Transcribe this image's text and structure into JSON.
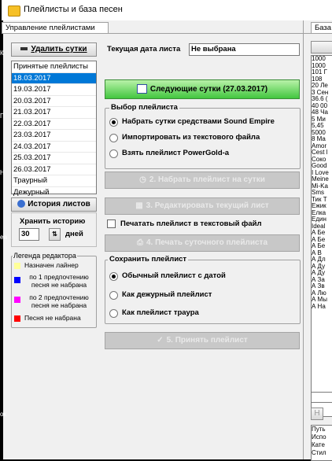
{
  "window": {
    "title": "Плейлисты и база песен"
  },
  "tabs": [
    "Управление плейлистами",
    "База"
  ],
  "left": {
    "delete_day_btn": "Удалить сутки",
    "list_header": "Принятые плейлисты",
    "playlists": [
      "18.03.2017",
      "19.03.2017",
      "20.03.2017",
      "21.03.2017",
      "22.03.2017",
      "23.03.2017",
      "24.03.2017",
      "25.03.2017",
      "26.03.2017",
      "Траурный",
      "Дежурный"
    ],
    "history_btn": "История листов",
    "keep_history_label": "Хранить историю",
    "keep_history_value": "30",
    "days_label": "дней",
    "legend": {
      "title": "Легенда редактора",
      "items": [
        {
          "color": "#ffff99",
          "label": "Назначен лайнер"
        },
        {
          "color": "#0000ff",
          "label": "по 1 предпочтению песня не набрана"
        },
        {
          "color": "#ff00ff",
          "label": "по 2 предпочтению песня не набрана"
        },
        {
          "color": "#ff0000",
          "label": "Песня не набрана"
        }
      ]
    }
  },
  "main": {
    "current_date_label": "Текущая дата листа",
    "current_date_value": "Не выбрана",
    "next_day_btn": "Следующие сутки (27.03.2017)",
    "select_group": {
      "title": "Выбор плейлиста",
      "options": [
        "Набрать сутки средствами Sound Empire",
        "Импортировать из текстового файла",
        "Взять плейлист PowerGold-а"
      ]
    },
    "step2_btn": "2. Набрать плейлист на сутки",
    "step3_btn": "3. Редактировать текущий лист",
    "print_to_file_label": "Печатать плейлист в текстовый файл",
    "step4_btn": "4. Печать суточного плейлиста",
    "save_group": {
      "title": "Сохранить плейлист",
      "options": [
        "Обычный плейлист с датой",
        "Как дежурный плейлист",
        "Как плейлист траура"
      ]
    },
    "step5_btn": "5. Принять плейлист"
  },
  "right_list": [
    "1000",
    "1000",
    "101 Г",
    "108",
    "20 Ле",
    "3 Сен",
    "36.6 (",
    "40 00",
    "48 Ча",
    "5 Ми",
    "5,45",
    "5000",
    "8 Ма",
    "Amor",
    "Cest l",
    "Соко",
    "Good",
    "I Love",
    "Meine",
    "Mi-Ka",
    "Sms",
    "Тик Т",
    "Ежик",
    "Ёлка",
    "Един",
    "Ideal",
    "А Бе",
    "А Бе",
    "А Бе",
    "А В",
    "А Дл",
    "А Ду",
    "А Ду",
    "А За",
    "А Зв",
    "А Лю",
    "А Мы",
    "А На"
  ],
  "right_bottom": {
    "field_labels": [
      "Путь",
      "Испо",
      "Кате",
      "Стил"
    ],
    "button_label": "Н"
  },
  "left_strip_text": [
    "К",
    "П",
    "Н",
    "еа",
    "ок"
  ]
}
